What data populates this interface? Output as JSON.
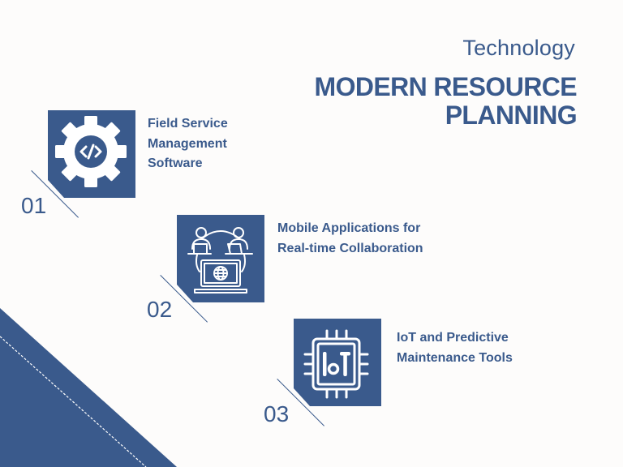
{
  "header": {
    "subtitle": "Technology",
    "title": "MODERN RESOURCE PLANNING"
  },
  "items": [
    {
      "number": "01",
      "label": "Field Service Management Software",
      "icon": "gear-code-icon"
    },
    {
      "number": "02",
      "label": "Mobile Applications for Real-time Collaboration",
      "icon": "team-collaboration-icon"
    },
    {
      "number": "03",
      "label": "IoT and Predictive Maintenance Tools",
      "icon": "iot-chip-icon"
    }
  ],
  "colors": {
    "accent": "#3a5a8c",
    "background": "#fdfcfb",
    "icon": "#ffffff"
  },
  "icon_text": {
    "code": "</>",
    "iot": "IoT"
  }
}
